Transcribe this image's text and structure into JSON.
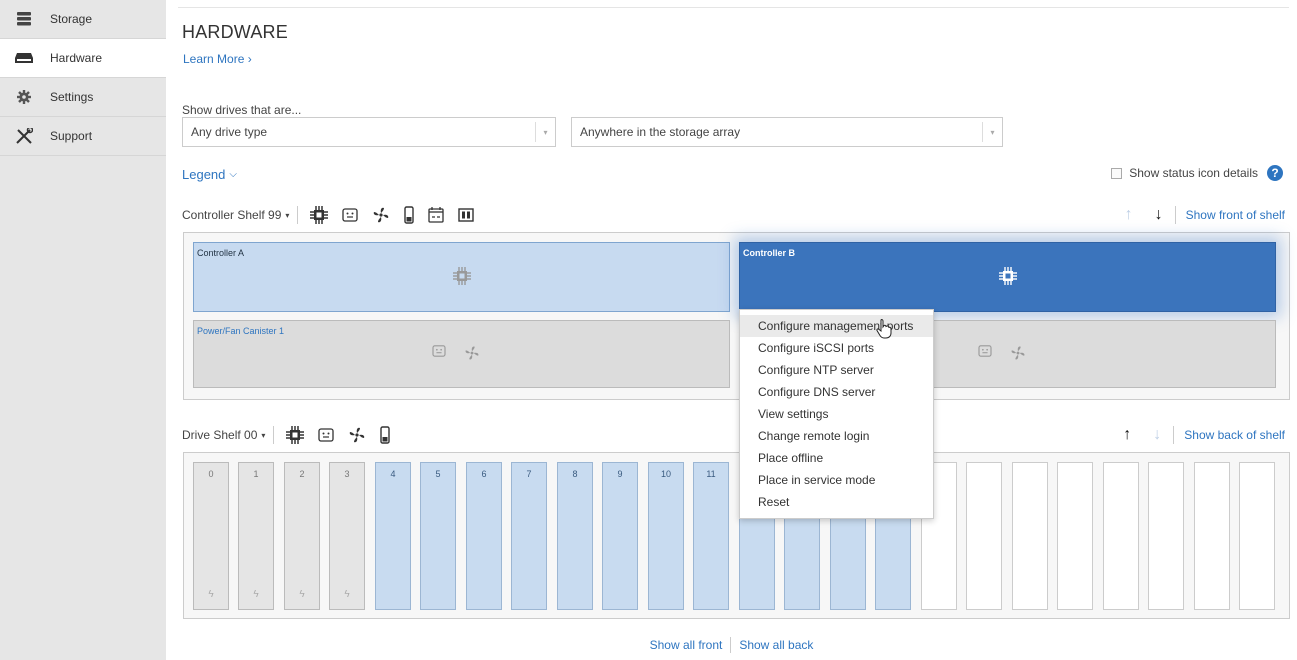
{
  "sidebar": {
    "items": [
      {
        "label": "Storage",
        "icon": "storage-icon"
      },
      {
        "label": "Hardware",
        "icon": "hardware-icon",
        "active": true
      },
      {
        "label": "Settings",
        "icon": "gear-icon"
      },
      {
        "label": "Support",
        "icon": "tools-icon"
      }
    ]
  },
  "page": {
    "title": "HARDWARE",
    "learn_more": "Learn More ›"
  },
  "filters": {
    "label": "Show drives that are...",
    "drive_type": "Any drive type",
    "location": "Anywhere in the storage array"
  },
  "legend": {
    "label": "Legend",
    "chevron": "⌵"
  },
  "status_details": {
    "label": "Show status icon details",
    "help": "?"
  },
  "controller_shelf": {
    "name": "Controller Shelf 99",
    "caret": "▾",
    "show_link": "Show front of shelf",
    "controller_a": "Controller A",
    "controller_b": "Controller B",
    "canister_1": "Power/Fan Canister 1"
  },
  "drive_shelf": {
    "name": "Drive Shelf 00",
    "caret": "▾",
    "show_link": "Show back of shelf",
    "drives": [
      "0",
      "1",
      "2",
      "3",
      "4",
      "5",
      "6",
      "7",
      "8",
      "9",
      "10",
      "11"
    ]
  },
  "context_menu": {
    "items": [
      "Configure management ports",
      "Configure iSCSI ports",
      "Configure NTP server",
      "Configure DNS server",
      "View settings",
      "Change remote login",
      "Place offline",
      "Place in service mode",
      "Reset"
    ]
  },
  "bottom": {
    "show_all_front": "Show all front",
    "show_all_back": "Show all back"
  },
  "colors": {
    "link": "#2e75c0",
    "selected_controller": "#3b74bc",
    "drive_fill": "#c8dbf0"
  }
}
